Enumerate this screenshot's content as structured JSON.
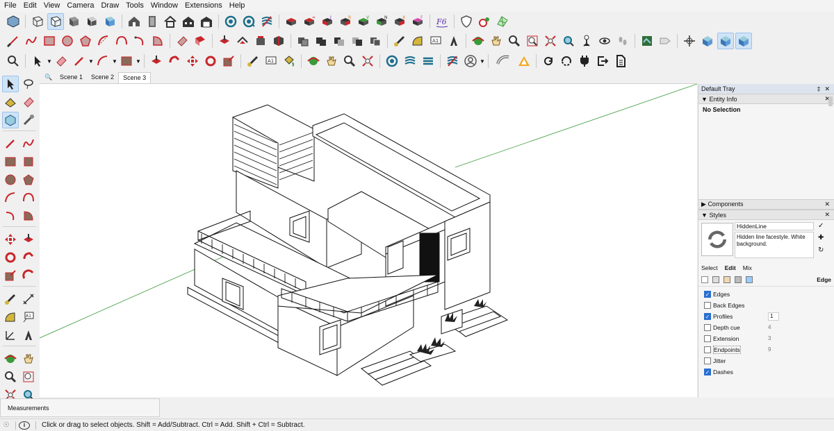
{
  "menu": [
    "File",
    "Edit",
    "View",
    "Camera",
    "Draw",
    "Tools",
    "Window",
    "Extensions",
    "Help"
  ],
  "scenes": [
    "Scene 1",
    "Scene 2",
    "Scene 3"
  ],
  "tray": {
    "title": "Default Tray",
    "entity_info": {
      "title": "Entity Info",
      "selection": "No Selection"
    },
    "components": {
      "title": "Components"
    },
    "styles": {
      "title": "Styles",
      "style_name": "HiddenLine",
      "style_desc": "Hidden line facestyle. White background.",
      "tabs": [
        "Select",
        "Edit",
        "Mix"
      ],
      "active_tab": "Edit",
      "section": "Edge",
      "options": [
        {
          "label": "Edges",
          "checked": true,
          "value": ""
        },
        {
          "label": "Back Edges",
          "checked": false,
          "value": ""
        },
        {
          "label": "Profiles",
          "checked": true,
          "value": "1"
        },
        {
          "label": "Depth cue",
          "checked": false,
          "value": "4"
        },
        {
          "label": "Extension",
          "checked": false,
          "value": "3"
        },
        {
          "label": "Endpoints",
          "checked": false,
          "value": "9"
        },
        {
          "label": "Jitter",
          "checked": false,
          "value": ""
        },
        {
          "label": "Dashes",
          "checked": true,
          "value": ""
        }
      ]
    }
  },
  "measurements_label": "Measurements",
  "status_text": "Click or drag to select objects. Shift = Add/Subtract. Ctrl = Add. Shift + Ctrl = Subtract.",
  "colors": {
    "accent": "#2a6fd1",
    "red": "#c8262b",
    "green_axis": "#3a9a3a"
  }
}
